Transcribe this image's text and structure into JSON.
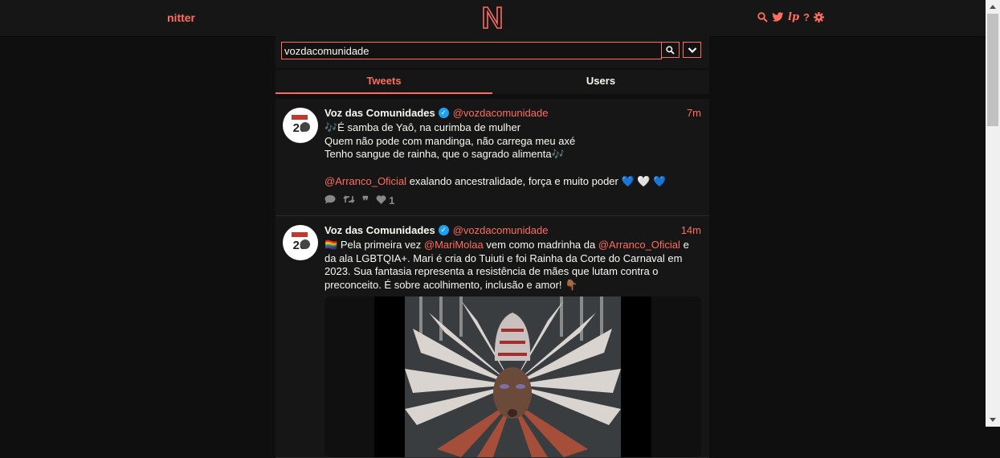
{
  "nav": {
    "brand": "nitter",
    "icons": [
      "search-icon",
      "twitter-bird-icon",
      "lp-icon",
      "help-icon",
      "gear-icon"
    ],
    "help_label": "?"
  },
  "search": {
    "value": "vozdacomunidade"
  },
  "tabs": [
    {
      "label": "Tweets",
      "active": true
    },
    {
      "label": "Users",
      "active": false
    }
  ],
  "tweets": [
    {
      "fullname": "Voz das Comunidades",
      "username": "@vozdacomunidade",
      "date": "7m",
      "lines": [
        "🎶É samba de Yaô, na curimba de mulher",
        "Quem não pode com mandinga, não carrega meu axé",
        "Tenho sangue de rainha, que o sagrado alimenta🎶"
      ],
      "mention": "@Arranco_Oficial",
      "tail": "exalando ancestralidade, força e muito poder",
      "hearts": [
        "💙",
        "🤍",
        "💙"
      ],
      "likes": "1"
    },
    {
      "fullname": "Voz das Comunidades",
      "username": "@vozdacomunidade",
      "date": "14m",
      "flag": "🏳️‍🌈",
      "p1": "Pela primeira vez",
      "mention1": "@MariMolaa",
      "p2": "vem como madrinha da",
      "mention2": "@Arranco_Oficial",
      "p3": "e da ala LGBTQIA+. Mari é cria do Tuiuti e foi Rainha da Corte do Carnaval em 2023. Sua fantasia representa a resistência de mães que lutam contra o preconceito. É sobre acolhimento, inclusão e amor!",
      "emoji_end": "👇🏾"
    }
  ],
  "colors": {
    "accent": "#ff6c60",
    "background": "#0f0f0f",
    "panel": "#161616",
    "verified": "#1da1f2"
  }
}
